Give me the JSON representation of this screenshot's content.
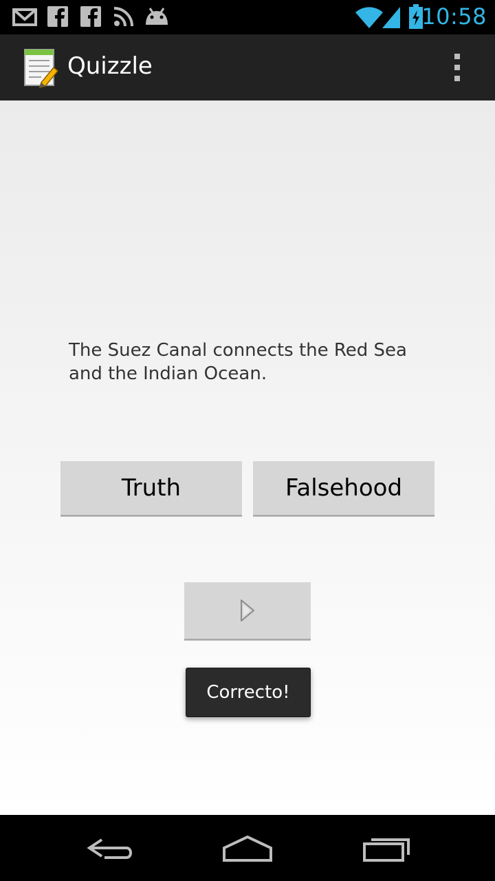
{
  "status_bar": {
    "time": "10:58",
    "notification_icons": [
      "gmail-icon",
      "facebook-icon",
      "facebook-icon",
      "rss-icon",
      "android-icon"
    ],
    "system_icons": [
      "wifi-icon",
      "signal-icon",
      "battery-charging-icon"
    ],
    "accent_color": "#33b5e5"
  },
  "action_bar": {
    "title": "Quizzle",
    "app_icon": "notepad-pencil-icon",
    "menu_icon": "overflow-menu-icon"
  },
  "quiz": {
    "question": "The Suez Canal connects the Red Sea and the Indian Ocean.",
    "true_label": "Truth",
    "false_label": "Falsehood",
    "next_icon": "next-arrow-icon"
  },
  "toast": {
    "message": "Correcto!"
  },
  "nav_bar": {
    "buttons": [
      "back-icon",
      "home-icon",
      "recent-apps-icon"
    ]
  }
}
